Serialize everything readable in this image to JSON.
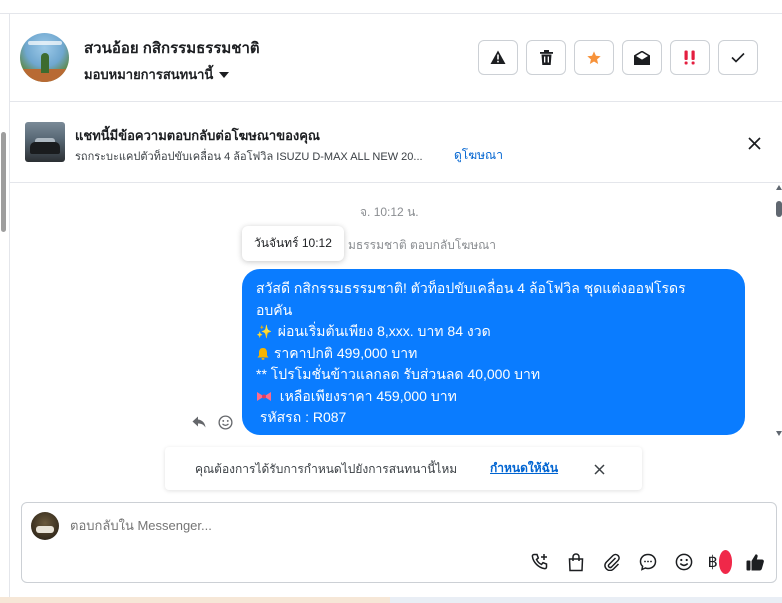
{
  "header": {
    "title": "สวนอ้อย กสิกรรมธรรมชาติ",
    "assign_label": "มอบหมายการสนทนานี้",
    "actions": [
      {
        "icon": "warning-icon",
        "tone": "#1c1e21"
      },
      {
        "icon": "trash-icon",
        "tone": "#1c1e21"
      },
      {
        "icon": "star-icon",
        "tone": "#f7923a"
      },
      {
        "icon": "mark-unread-icon",
        "tone": "#1c1e21"
      },
      {
        "icon": "important-icon",
        "tone": "#e41e3f"
      },
      {
        "icon": "checkmark-icon",
        "tone": "#1c1e21"
      }
    ]
  },
  "ad_banner": {
    "title": "แชทนี้มีข้อความตอบกลับต่อโฆษณาของคุณ",
    "subtitle": "รถกระบะแคปตัวท็อปขับเคลื่อน 4 ล้อโฟวิล ISUZU D-MAX ALL NEW 20...",
    "link": "ดูโฆษณา"
  },
  "conversation": {
    "timestamp": "จ. 10:12 น.",
    "tooltip": "วันจันทร์ 10:12",
    "replied_note": "มธรรมชาติ ตอบกลับโฆษณา",
    "message": {
      "line1": "สวัสดี กสิกรรมธรรมชาติ! ตัวท็อปขับเคลื่อน 4 ล้อโฟวิล ชุดแต่งออฟโรดร",
      "line2": "อบคัน",
      "line3": "ผ่อนเริ่มต้นเพียง 8,xxx. บาท 84 งวด",
      "line4": "ราคาปกติ 499,000 บาท",
      "line5": "** โปรโมชั่นข้าวแลกลด รับส่วนลด 40,000 บาท",
      "line6": "เหลือเพียงราคา 459,000 บาท",
      "line7": "รหัสรถ : R087"
    },
    "suggestion": {
      "text": "คุณต้องการได้รับการกำหนดไปยังการสนทนานี้ไหม",
      "link": "กำหนดให้ฉัน"
    }
  },
  "composer": {
    "placeholder": "ตอบกลับใน Messenger...",
    "baht_symbol": "฿",
    "icons": [
      "add-call-icon",
      "bag-icon",
      "attachment-icon",
      "chat-bubble-icon",
      "emoji-icon",
      "baht-icon",
      "thumbs-up-icon"
    ]
  },
  "colors": {
    "bubble": "#0a7cff",
    "link": "#0064d1",
    "star": "#f7923a",
    "important": "#e41e3f"
  }
}
